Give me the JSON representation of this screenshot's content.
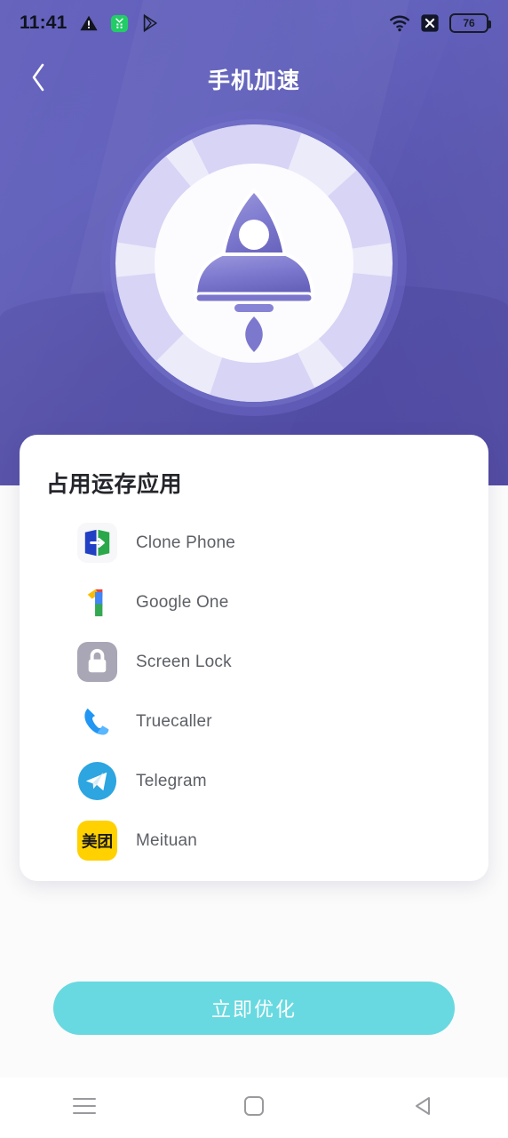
{
  "status_bar": {
    "time": "11:41",
    "left_icons": [
      "warning-triangle-icon",
      "green-app-icon",
      "play-store-icon"
    ],
    "right_icons": [
      "wifi-icon",
      "no-sim-icon"
    ],
    "battery_level": "76"
  },
  "app_bar": {
    "back_icon": "chevron-left-icon",
    "title": "手机加速"
  },
  "hero": {
    "illustration": "rocket-medallion-icon",
    "colors": {
      "bg_top": "#5a57b8",
      "bg_bottom": "#554fa8",
      "ring": "#6d69c7",
      "rocket": "#6f6bc4"
    }
  },
  "card": {
    "title": "占用运存应用",
    "apps": [
      {
        "name": "Clone Phone",
        "icon": "clone-phone-icon"
      },
      {
        "name": "Google One",
        "icon": "google-one-icon"
      },
      {
        "name": "Screen Lock",
        "icon": "screen-lock-icon"
      },
      {
        "name": "Truecaller",
        "icon": "truecaller-icon"
      },
      {
        "name": "Telegram",
        "icon": "telegram-icon"
      },
      {
        "name": "Meituan",
        "icon": "meituan-icon",
        "glyph": "美团"
      }
    ]
  },
  "cta": {
    "label": "立即优化",
    "color": "#68d9e0"
  },
  "nav_bar": {
    "recents_icon": "menu-icon",
    "home_icon": "square-icon",
    "back_icon": "triangle-back-icon"
  }
}
